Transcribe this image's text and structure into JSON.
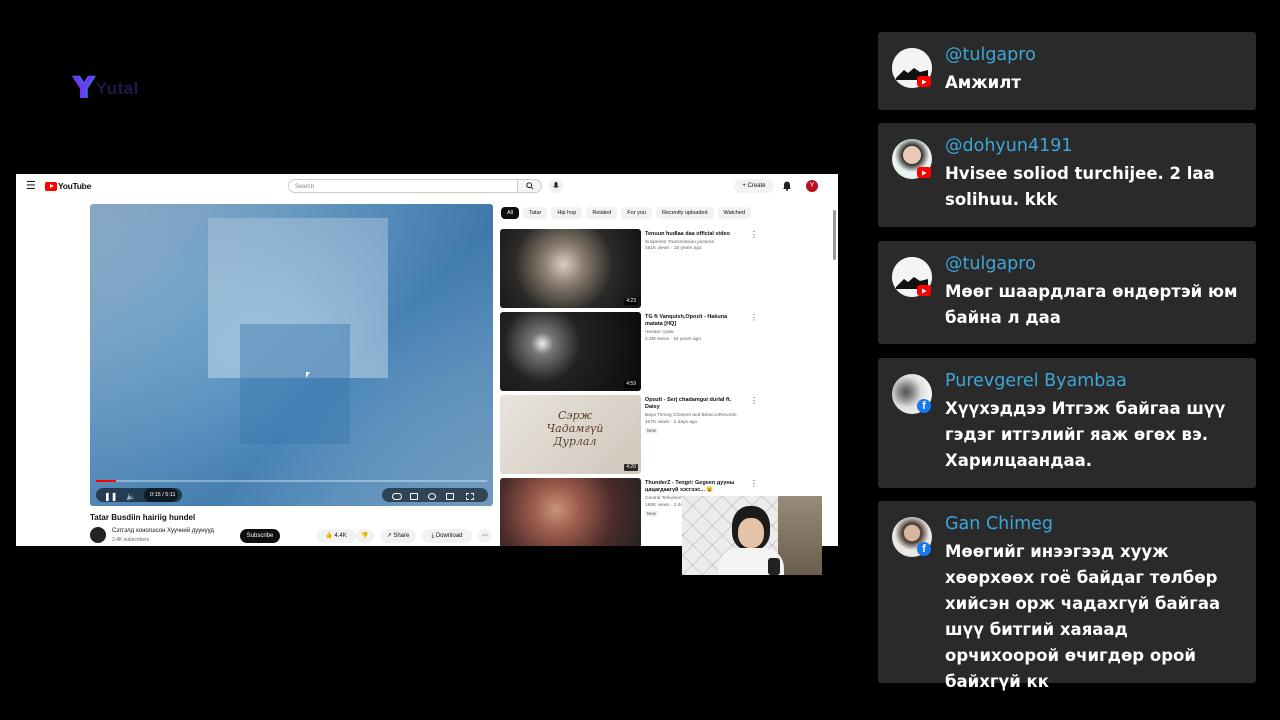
{
  "overlay": {
    "logo_text": "Yutal"
  },
  "youtube": {
    "brand": "YouTube",
    "search_placeholder": "Search",
    "create_label": "Create",
    "avatar_letter": "Y",
    "player": {
      "current_time": "0:15 / 5:11",
      "progress": 0.05
    },
    "video_title": "Tatar Busdiin hairiig hundel",
    "channel_name": "Сэтгэлд хоногшсон Хуучний дуунууд",
    "channel_subs": "2.4K subscribers",
    "subscribe_label": "Subscribe",
    "like_count": "4.4K",
    "share_label": "Share",
    "download_label": "Download",
    "chips": [
      "All",
      "Tatar",
      "Hip hop",
      "Related",
      "For you",
      "Recently uploaded",
      "Watched"
    ],
    "recommendations": [
      {
        "title": "Tenuun hudlaa daa official video",
        "channel": "Suspense Transmission pictures",
        "meta": "451K views · 15 years ago",
        "duration": "4:23",
        "badge": ""
      },
      {
        "title": "TG ft Vanquish,Opozit - Hakuna matata [HQ]",
        "channel": "Чөлөөт сувaг",
        "meta": "2.3M views · 15 years ago",
        "duration": "4:59",
        "badge": ""
      },
      {
        "title": "Opozit - Serj chadamgui durlal ft. Daisy",
        "channel": "Bayа Tomog Channel and BelaccoRecords",
        "meta": "107K views · 2 days ago",
        "duration": "4:20",
        "badge": "New",
        "thumb_text": "Сэрж Чадамгүй Дурлал"
      },
      {
        "title": "ThunderZ - Tengri: Gegeen дууны цацагдаагүй хэсгээс... 😮",
        "channel": "Central Television",
        "meta": "180K views · 2 days ago",
        "duration": "",
        "badge": "New"
      }
    ]
  },
  "chat": [
    {
      "name": "@tulgapro",
      "message": "Амжилт",
      "platform": "youtube"
    },
    {
      "name": "@dohyun4191",
      "message": "Hvisee soliod turchijee. 2 laa solihuu. kkk",
      "platform": "youtube"
    },
    {
      "name": "@tulgapro",
      "message": "Мөөг шаардлага өндөртэй юм байна л даа",
      "platform": "youtube"
    },
    {
      "name": "Purevgerel Byambaa",
      "message": "Хүүхэддээ Итгэж байгаа шүү гэдэг итгэлийг яаж өгөх вэ. Харилцаандаа.",
      "platform": "facebook"
    },
    {
      "name": "Gan Chimeg",
      "message": "Мөөгийг инээгээд хууж хөөрхөөх гоё байдаг төлбөр хийсэн орж чадахгүй байгаа шүү битгий хаяаад орчихоорой өчигдөр орой байхгүй кк",
      "platform": "facebook"
    }
  ],
  "colors": {
    "accent_name": "#3ea6d8",
    "youtube_red": "#ff0000",
    "facebook_blue": "#1877f2",
    "card_bg": "#2a2a2a"
  }
}
